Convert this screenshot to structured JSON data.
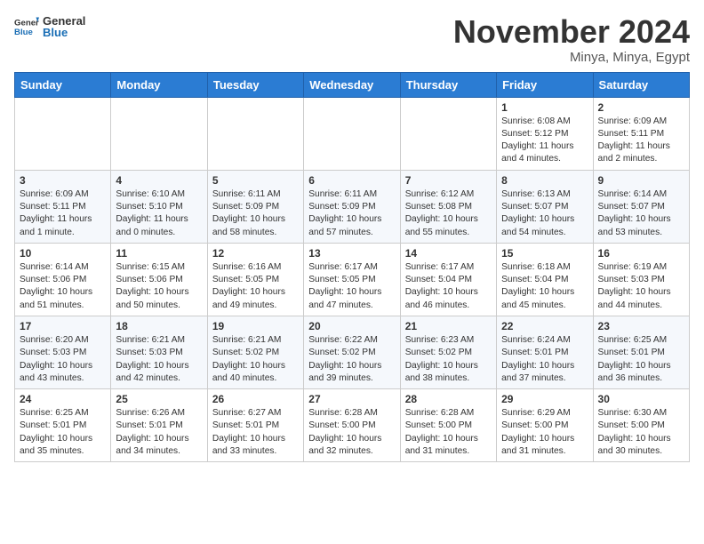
{
  "header": {
    "logo_general": "General",
    "logo_blue": "Blue",
    "month_title": "November 2024",
    "location": "Minya, Minya, Egypt"
  },
  "weekdays": [
    "Sunday",
    "Monday",
    "Tuesday",
    "Wednesday",
    "Thursday",
    "Friday",
    "Saturday"
  ],
  "weeks": [
    [
      {
        "day": "",
        "info": ""
      },
      {
        "day": "",
        "info": ""
      },
      {
        "day": "",
        "info": ""
      },
      {
        "day": "",
        "info": ""
      },
      {
        "day": "",
        "info": ""
      },
      {
        "day": "1",
        "info": "Sunrise: 6:08 AM\nSunset: 5:12 PM\nDaylight: 11 hours\nand 4 minutes."
      },
      {
        "day": "2",
        "info": "Sunrise: 6:09 AM\nSunset: 5:11 PM\nDaylight: 11 hours\nand 2 minutes."
      }
    ],
    [
      {
        "day": "3",
        "info": "Sunrise: 6:09 AM\nSunset: 5:11 PM\nDaylight: 11 hours\nand 1 minute."
      },
      {
        "day": "4",
        "info": "Sunrise: 6:10 AM\nSunset: 5:10 PM\nDaylight: 11 hours\nand 0 minutes."
      },
      {
        "day": "5",
        "info": "Sunrise: 6:11 AM\nSunset: 5:09 PM\nDaylight: 10 hours\nand 58 minutes."
      },
      {
        "day": "6",
        "info": "Sunrise: 6:11 AM\nSunset: 5:09 PM\nDaylight: 10 hours\nand 57 minutes."
      },
      {
        "day": "7",
        "info": "Sunrise: 6:12 AM\nSunset: 5:08 PM\nDaylight: 10 hours\nand 55 minutes."
      },
      {
        "day": "8",
        "info": "Sunrise: 6:13 AM\nSunset: 5:07 PM\nDaylight: 10 hours\nand 54 minutes."
      },
      {
        "day": "9",
        "info": "Sunrise: 6:14 AM\nSunset: 5:07 PM\nDaylight: 10 hours\nand 53 minutes."
      }
    ],
    [
      {
        "day": "10",
        "info": "Sunrise: 6:14 AM\nSunset: 5:06 PM\nDaylight: 10 hours\nand 51 minutes."
      },
      {
        "day": "11",
        "info": "Sunrise: 6:15 AM\nSunset: 5:06 PM\nDaylight: 10 hours\nand 50 minutes."
      },
      {
        "day": "12",
        "info": "Sunrise: 6:16 AM\nSunset: 5:05 PM\nDaylight: 10 hours\nand 49 minutes."
      },
      {
        "day": "13",
        "info": "Sunrise: 6:17 AM\nSunset: 5:05 PM\nDaylight: 10 hours\nand 47 minutes."
      },
      {
        "day": "14",
        "info": "Sunrise: 6:17 AM\nSunset: 5:04 PM\nDaylight: 10 hours\nand 46 minutes."
      },
      {
        "day": "15",
        "info": "Sunrise: 6:18 AM\nSunset: 5:04 PM\nDaylight: 10 hours\nand 45 minutes."
      },
      {
        "day": "16",
        "info": "Sunrise: 6:19 AM\nSunset: 5:03 PM\nDaylight: 10 hours\nand 44 minutes."
      }
    ],
    [
      {
        "day": "17",
        "info": "Sunrise: 6:20 AM\nSunset: 5:03 PM\nDaylight: 10 hours\nand 43 minutes."
      },
      {
        "day": "18",
        "info": "Sunrise: 6:21 AM\nSunset: 5:03 PM\nDaylight: 10 hours\nand 42 minutes."
      },
      {
        "day": "19",
        "info": "Sunrise: 6:21 AM\nSunset: 5:02 PM\nDaylight: 10 hours\nand 40 minutes."
      },
      {
        "day": "20",
        "info": "Sunrise: 6:22 AM\nSunset: 5:02 PM\nDaylight: 10 hours\nand 39 minutes."
      },
      {
        "day": "21",
        "info": "Sunrise: 6:23 AM\nSunset: 5:02 PM\nDaylight: 10 hours\nand 38 minutes."
      },
      {
        "day": "22",
        "info": "Sunrise: 6:24 AM\nSunset: 5:01 PM\nDaylight: 10 hours\nand 37 minutes."
      },
      {
        "day": "23",
        "info": "Sunrise: 6:25 AM\nSunset: 5:01 PM\nDaylight: 10 hours\nand 36 minutes."
      }
    ],
    [
      {
        "day": "24",
        "info": "Sunrise: 6:25 AM\nSunset: 5:01 PM\nDaylight: 10 hours\nand 35 minutes."
      },
      {
        "day": "25",
        "info": "Sunrise: 6:26 AM\nSunset: 5:01 PM\nDaylight: 10 hours\nand 34 minutes."
      },
      {
        "day": "26",
        "info": "Sunrise: 6:27 AM\nSunset: 5:01 PM\nDaylight: 10 hours\nand 33 minutes."
      },
      {
        "day": "27",
        "info": "Sunrise: 6:28 AM\nSunset: 5:00 PM\nDaylight: 10 hours\nand 32 minutes."
      },
      {
        "day": "28",
        "info": "Sunrise: 6:28 AM\nSunset: 5:00 PM\nDaylight: 10 hours\nand 31 minutes."
      },
      {
        "day": "29",
        "info": "Sunrise: 6:29 AM\nSunset: 5:00 PM\nDaylight: 10 hours\nand 31 minutes."
      },
      {
        "day": "30",
        "info": "Sunrise: 6:30 AM\nSunset: 5:00 PM\nDaylight: 10 hours\nand 30 minutes."
      }
    ]
  ]
}
